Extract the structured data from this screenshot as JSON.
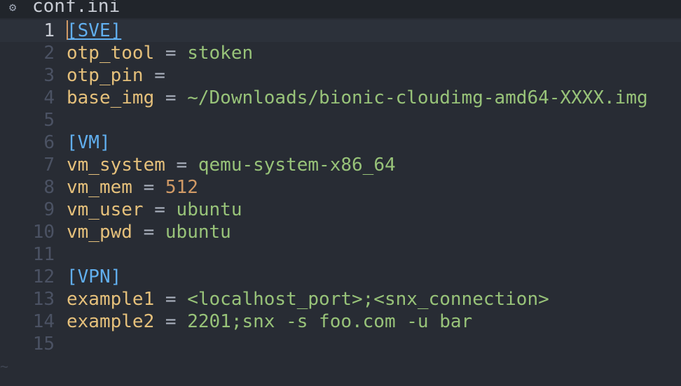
{
  "tab": {
    "icon": "gear-icon",
    "title": "conf.ini"
  },
  "editor": {
    "lines": [
      {
        "num": "1",
        "current": true,
        "tokens": [
          {
            "t": "section",
            "v": "[SVE]"
          }
        ]
      },
      {
        "num": "2",
        "tokens": [
          {
            "t": "key",
            "v": "otp_tool"
          },
          {
            "t": "op",
            "v": " = "
          },
          {
            "t": "str",
            "v": "stoken"
          }
        ]
      },
      {
        "num": "3",
        "tokens": [
          {
            "t": "key",
            "v": "otp_pin"
          },
          {
            "t": "op",
            "v": " ="
          }
        ]
      },
      {
        "num": "4",
        "tokens": [
          {
            "t": "key",
            "v": "base_img"
          },
          {
            "t": "op",
            "v": " = "
          },
          {
            "t": "str",
            "v": "~/Downloads/bionic-cloudimg-amd64-XXXX.img"
          }
        ]
      },
      {
        "num": "5",
        "tokens": []
      },
      {
        "num": "6",
        "tokens": [
          {
            "t": "section",
            "v": "[VM]"
          }
        ]
      },
      {
        "num": "7",
        "tokens": [
          {
            "t": "key",
            "v": "vm_system"
          },
          {
            "t": "op",
            "v": " = "
          },
          {
            "t": "str",
            "v": "qemu-system-x86_64"
          }
        ]
      },
      {
        "num": "8",
        "tokens": [
          {
            "t": "key",
            "v": "vm_mem"
          },
          {
            "t": "op",
            "v": " = "
          },
          {
            "t": "num",
            "v": "512"
          }
        ]
      },
      {
        "num": "9",
        "tokens": [
          {
            "t": "key",
            "v": "vm_user"
          },
          {
            "t": "op",
            "v": " = "
          },
          {
            "t": "str",
            "v": "ubuntu"
          }
        ]
      },
      {
        "num": "10",
        "tokens": [
          {
            "t": "key",
            "v": "vm_pwd"
          },
          {
            "t": "op",
            "v": " = "
          },
          {
            "t": "str",
            "v": "ubuntu"
          }
        ]
      },
      {
        "num": "11",
        "tokens": []
      },
      {
        "num": "12",
        "tokens": [
          {
            "t": "section",
            "v": "[VPN]"
          }
        ]
      },
      {
        "num": "13",
        "tokens": [
          {
            "t": "key",
            "v": "example1"
          },
          {
            "t": "op",
            "v": " = "
          },
          {
            "t": "str",
            "v": "<localhost_port>;<snx_connection>"
          }
        ]
      },
      {
        "num": "14",
        "tokens": [
          {
            "t": "key",
            "v": "example2"
          },
          {
            "t": "op",
            "v": " = "
          },
          {
            "t": "str",
            "v": "2201;snx -s foo.com -u bar"
          }
        ]
      },
      {
        "num": "15",
        "tokens": []
      }
    ],
    "end_marker": "~"
  },
  "colors": {
    "background": "#282c34",
    "section": "#61afef",
    "key": "#e5c07b",
    "string": "#98c379",
    "number": "#d19a66"
  }
}
